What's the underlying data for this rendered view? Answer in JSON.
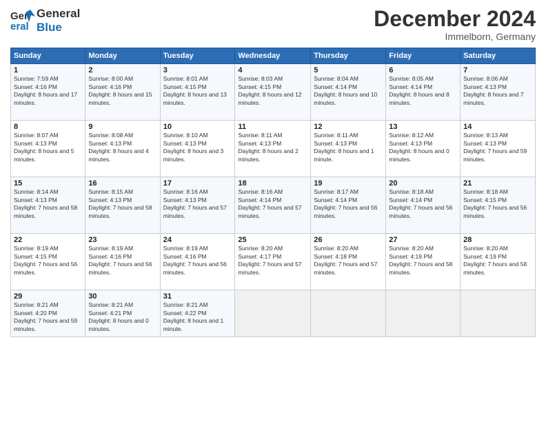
{
  "header": {
    "logo_line1": "General",
    "logo_line2": "Blue",
    "month": "December 2024",
    "location": "Immelborn, Germany"
  },
  "days_of_week": [
    "Sunday",
    "Monday",
    "Tuesday",
    "Wednesday",
    "Thursday",
    "Friday",
    "Saturday"
  ],
  "weeks": [
    [
      {
        "day": "1",
        "rise": "7:59 AM",
        "set": "4:16 PM",
        "daylight": "8 hours and 17 minutes."
      },
      {
        "day": "2",
        "rise": "8:00 AM",
        "set": "4:16 PM",
        "daylight": "8 hours and 15 minutes."
      },
      {
        "day": "3",
        "rise": "8:01 AM",
        "set": "4:15 PM",
        "daylight": "8 hours and 13 minutes."
      },
      {
        "day": "4",
        "rise": "8:03 AM",
        "set": "4:15 PM",
        "daylight": "8 hours and 12 minutes."
      },
      {
        "day": "5",
        "rise": "8:04 AM",
        "set": "4:14 PM",
        "daylight": "8 hours and 10 minutes."
      },
      {
        "day": "6",
        "rise": "8:05 AM",
        "set": "4:14 PM",
        "daylight": "8 hours and 8 minutes."
      },
      {
        "day": "7",
        "rise": "8:06 AM",
        "set": "4:13 PM",
        "daylight": "8 hours and 7 minutes."
      }
    ],
    [
      {
        "day": "8",
        "rise": "8:07 AM",
        "set": "4:13 PM",
        "daylight": "8 hours and 5 minutes."
      },
      {
        "day": "9",
        "rise": "8:08 AM",
        "set": "4:13 PM",
        "daylight": "8 hours and 4 minutes."
      },
      {
        "day": "10",
        "rise": "8:10 AM",
        "set": "4:13 PM",
        "daylight": "8 hours and 3 minutes."
      },
      {
        "day": "11",
        "rise": "8:11 AM",
        "set": "4:13 PM",
        "daylight": "8 hours and 2 minutes."
      },
      {
        "day": "12",
        "rise": "8:11 AM",
        "set": "4:13 PM",
        "daylight": "8 hours and 1 minute."
      },
      {
        "day": "13",
        "rise": "8:12 AM",
        "set": "4:13 PM",
        "daylight": "8 hours and 0 minutes."
      },
      {
        "day": "14",
        "rise": "8:13 AM",
        "set": "4:13 PM",
        "daylight": "7 hours and 59 minutes."
      }
    ],
    [
      {
        "day": "15",
        "rise": "8:14 AM",
        "set": "4:13 PM",
        "daylight": "7 hours and 58 minutes."
      },
      {
        "day": "16",
        "rise": "8:15 AM",
        "set": "4:13 PM",
        "daylight": "7 hours and 58 minutes."
      },
      {
        "day": "17",
        "rise": "8:16 AM",
        "set": "4:13 PM",
        "daylight": "7 hours and 57 minutes."
      },
      {
        "day": "18",
        "rise": "8:16 AM",
        "set": "4:14 PM",
        "daylight": "7 hours and 57 minutes."
      },
      {
        "day": "19",
        "rise": "8:17 AM",
        "set": "4:14 PM",
        "daylight": "7 hours and 56 minutes."
      },
      {
        "day": "20",
        "rise": "8:18 AM",
        "set": "4:14 PM",
        "daylight": "7 hours and 56 minutes."
      },
      {
        "day": "21",
        "rise": "8:18 AM",
        "set": "4:15 PM",
        "daylight": "7 hours and 56 minutes."
      }
    ],
    [
      {
        "day": "22",
        "rise": "8:19 AM",
        "set": "4:15 PM",
        "daylight": "7 hours and 56 minutes."
      },
      {
        "day": "23",
        "rise": "8:19 AM",
        "set": "4:16 PM",
        "daylight": "7 hours and 56 minutes."
      },
      {
        "day": "24",
        "rise": "8:19 AM",
        "set": "4:16 PM",
        "daylight": "7 hours and 56 minutes."
      },
      {
        "day": "25",
        "rise": "8:20 AM",
        "set": "4:17 PM",
        "daylight": "7 hours and 57 minutes."
      },
      {
        "day": "26",
        "rise": "8:20 AM",
        "set": "4:18 PM",
        "daylight": "7 hours and 57 minutes."
      },
      {
        "day": "27",
        "rise": "8:20 AM",
        "set": "4:19 PM",
        "daylight": "7 hours and 58 minutes."
      },
      {
        "day": "28",
        "rise": "8:20 AM",
        "set": "4:19 PM",
        "daylight": "7 hours and 58 minutes."
      }
    ],
    [
      {
        "day": "29",
        "rise": "8:21 AM",
        "set": "4:20 PM",
        "daylight": "7 hours and 59 minutes."
      },
      {
        "day": "30",
        "rise": "8:21 AM",
        "set": "4:21 PM",
        "daylight": "8 hours and 0 minutes."
      },
      {
        "day": "31",
        "rise": "8:21 AM",
        "set": "4:22 PM",
        "daylight": "8 hours and 1 minute."
      },
      null,
      null,
      null,
      null
    ]
  ],
  "labels": {
    "sunrise": "Sunrise:",
    "sunset": "Sunset:",
    "daylight": "Daylight:"
  }
}
